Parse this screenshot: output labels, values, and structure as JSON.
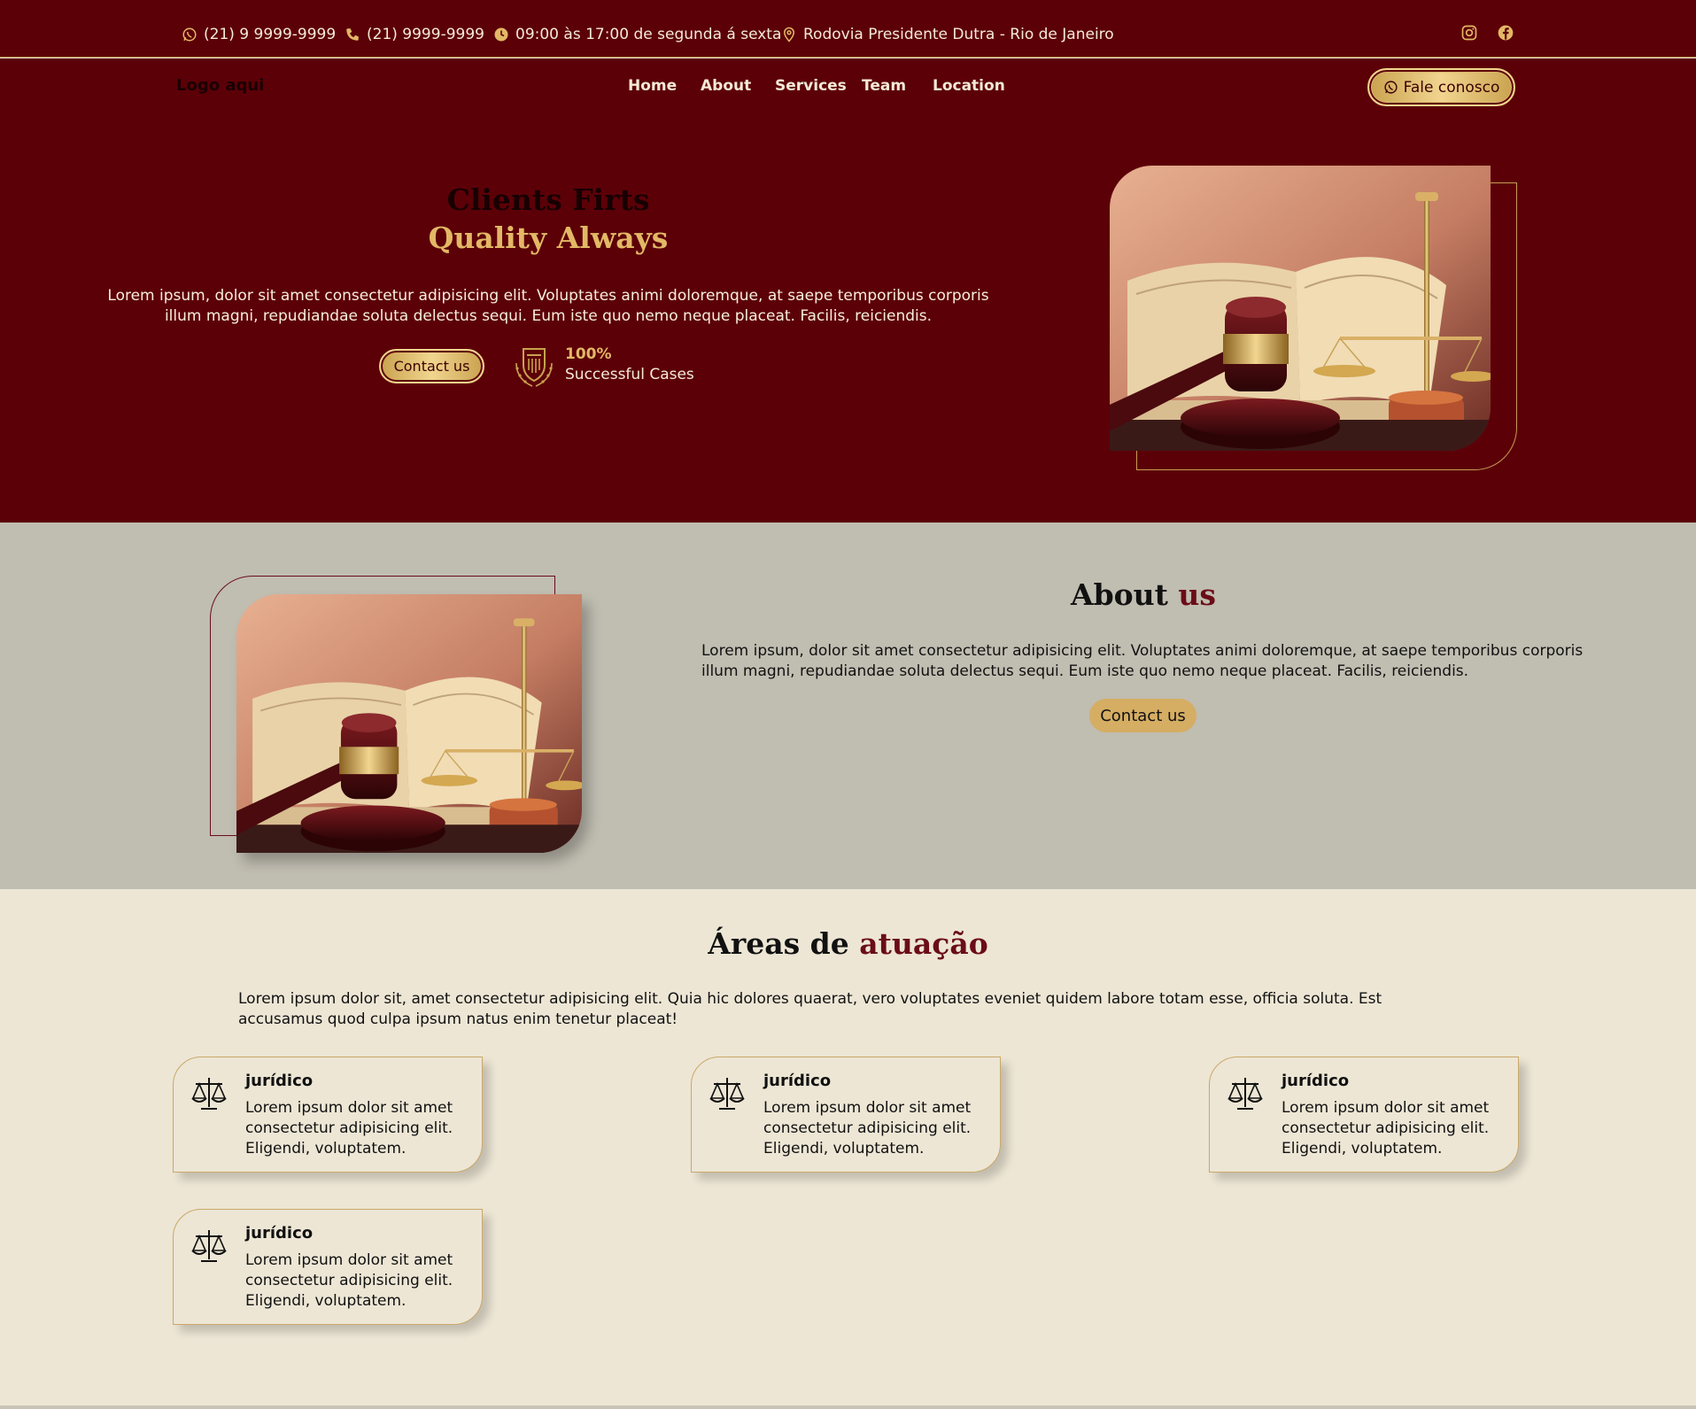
{
  "topbar": {
    "whatsapp": "(21) 9 9999-9999",
    "phone": "(21) 9999-9999",
    "hours": "09:00 às 17:00 de segunda á sexta",
    "address": "Rodovia Presidente Dutra - Rio de Janeiro",
    "icons": [
      "whatsapp-icon",
      "phone-icon",
      "clock-icon",
      "location-pin-icon",
      "instagram-icon",
      "facebook-icon"
    ]
  },
  "nav": {
    "logo": "Logo aqui",
    "links": [
      "Home",
      "About",
      "Services",
      "Team",
      "Location"
    ],
    "cta": "Fale conosco"
  },
  "hero": {
    "title_line1": "Clients Firts",
    "title_line2": "Quality Always",
    "text": "Lorem ipsum, dolor sit amet consectetur adipisicing elit. Voluptates animi doloremque, at saepe temporibus corporis illum magni, repudiandae soluta delectus sequi. Eum iste quo nemo neque placeat. Facilis, reiciendis.",
    "button": "Contact us",
    "badge_value": "100%",
    "badge_label": "Successful Cases"
  },
  "about": {
    "title_main": "About",
    "title_accent": "us",
    "text": "Lorem ipsum, dolor sit amet consectetur adipisicing elit. Voluptates animi doloremque, at saepe temporibus corporis illum magni, repudiandae soluta delectus sequi. Eum iste quo nemo neque placeat. Facilis, reiciendis.",
    "button": "Contact us"
  },
  "areas": {
    "title_main": "Áreas de",
    "title_accent": "atuação",
    "text": "Lorem ipsum dolor sit, amet consectetur adipisicing elit. Quia hic dolores quaerat, vero voluptates eveniet quidem labore totam esse, officia soluta. Est accusamus quod culpa ipsum natus enim tenetur placeat!",
    "cards": [
      {
        "title": "jurídico",
        "text": "Lorem ipsum dolor sit amet consectetur adipisicing elit. Eligendi, voluptatem."
      },
      {
        "title": "jurídico",
        "text": "Lorem ipsum dolor sit amet consectetur adipisicing elit. Eligendi, voluptatem."
      },
      {
        "title": "jurídico",
        "text": "Lorem ipsum dolor sit amet consectetur adipisicing elit. Eligendi, voluptatem."
      },
      {
        "title": "jurídico",
        "text": "Lorem ipsum dolor sit amet consectetur adipisicing elit. Eligendi, voluptatem."
      }
    ]
  },
  "colors": {
    "primary": "#5c0008",
    "gold": "#e2b866",
    "about_bg": "#c0bdb1",
    "areas_bg": "#ede6d5",
    "accent_text": "#6a0d18"
  }
}
